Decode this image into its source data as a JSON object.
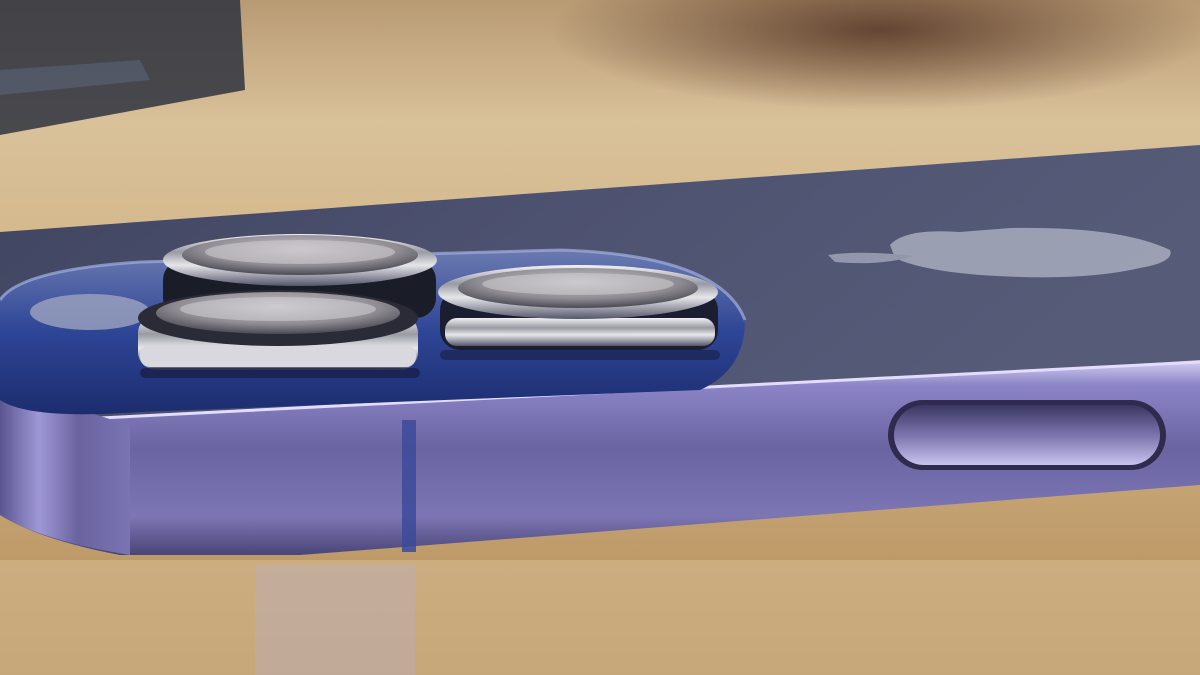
{
  "scene": {
    "description_free": true,
    "subject": "smartphone-rear-camera-closeup",
    "colors": {
      "table_light": "#e6cfa3",
      "table_mid": "#c9a46e",
      "table_dark": "#8a6a48",
      "phone_back": "#4a4f68",
      "phone_frame": "#6f6aa8",
      "frame_highlight": "#b9b3e6",
      "camera_bump": "#2c3f86",
      "lens_metal": "#c9c6cc",
      "lens_dark": "#151722",
      "logo": "#9aa0b2"
    },
    "lens_count": 3,
    "icons": [
      "apple-logo-icon",
      "side-button-icon"
    ]
  }
}
